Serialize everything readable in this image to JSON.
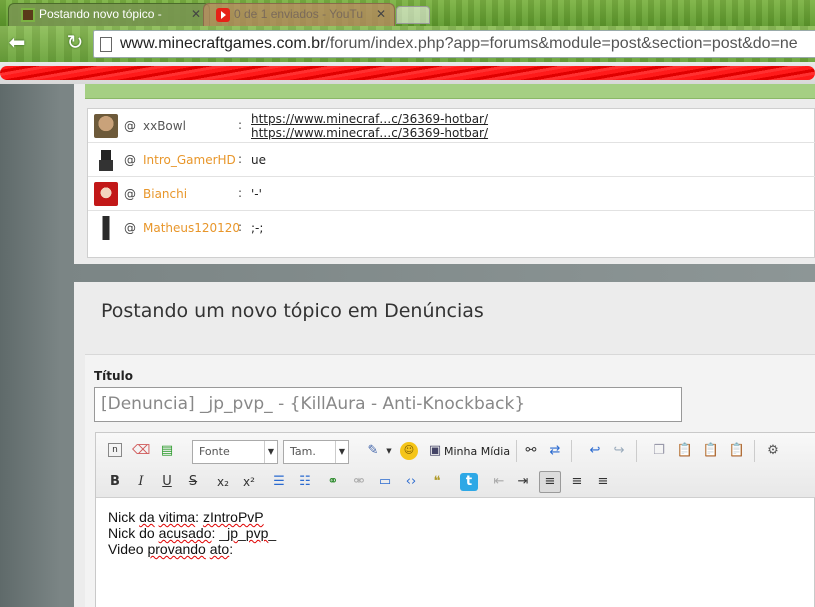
{
  "browser": {
    "tabs": [
      {
        "title": "Postando novo tópico - ",
        "active": true
      },
      {
        "title": "0 de 1 enviados - YouTu",
        "active": false
      }
    ],
    "url_domain": "www.minecraftgames.com.br",
    "url_path": "/forum/index.php?app=forums&module=post&section=post&do=ne"
  },
  "shoutbox": {
    "rows": [
      {
        "at": "@",
        "nick": "xxBowl",
        "colon": ":",
        "links": [
          "https://www.minecraf…c/36369-hotbar/",
          "https://www.minecraf…c/36369-hotbar/"
        ],
        "message": ""
      },
      {
        "at": "@",
        "nick": "Intro_GamerHD",
        "colon": ":",
        "links": [],
        "message": "ue"
      },
      {
        "at": "@",
        "nick": "Bianchi",
        "colon": ":",
        "links": [],
        "message": "'-'"
      },
      {
        "at": "@",
        "nick": "Matheus120120",
        "colon": ":",
        "links": [],
        "message": ";-;"
      }
    ]
  },
  "post": {
    "heading": "Postando um novo tópico em Denúncias",
    "title_label": "Título",
    "title_value": "[Denuncia] _jp_pvp_ - {KillAura - Anti-Knockback}",
    "toolbar": {
      "font_select": "Fonte",
      "size_select": "Tam.",
      "media_label": "Minha Mídia",
      "bold": "B",
      "italic": "I",
      "underline": "U",
      "strike": "S"
    },
    "body": {
      "line1_a": "Nick ",
      "line1_b": "da",
      "line1_c": " ",
      "line1_d": "vitima",
      "line1_e": ": ",
      "line1_f": "zIntroPvP",
      "line2_a": "Nick do ",
      "line2_b": "acusado",
      "line2_c": ": _",
      "line2_d": "jp",
      "line2_e": "_",
      "line2_f": "pvp",
      "line2_g": "_",
      "line3_a": "Video ",
      "line3_b": "provando",
      "line3_c": " ",
      "line3_d": "ato",
      "line3_e": ":"
    }
  }
}
